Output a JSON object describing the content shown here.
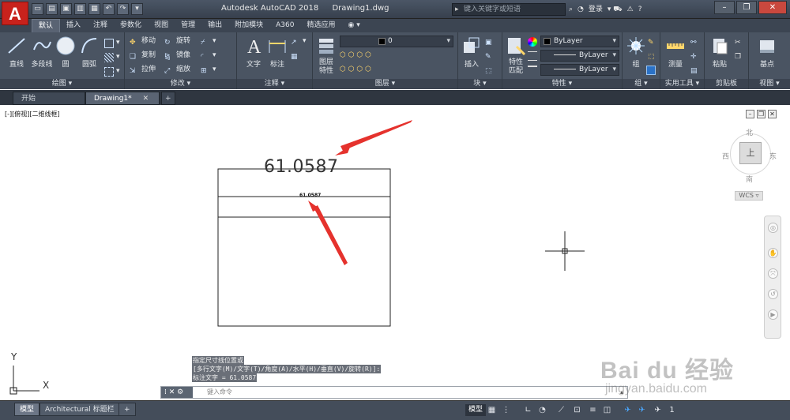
{
  "app": {
    "logo_letter": "A",
    "title_app": "Autodesk AutoCAD 2018",
    "title_file": "Drawing1.dwg",
    "search_placeholder": "键入关键字或短语",
    "signin_label": "登录"
  },
  "ribbon_tabs": [
    "默认",
    "插入",
    "注释",
    "参数化",
    "视图",
    "管理",
    "输出",
    "附加模块",
    "A360",
    "精选应用"
  ],
  "ribbon_active_tab": "默认",
  "panels": {
    "draw": {
      "title": "绘图 ▾",
      "tools": {
        "line": "直线",
        "polyline": "多段线",
        "circle": "圆",
        "arc": "圆弧"
      }
    },
    "modify": {
      "title": "修改 ▾",
      "tools": {
        "move": "移动",
        "rotate": "旋转",
        "copy": "复制",
        "mirror": "镜像",
        "stretch": "拉伸",
        "scale": "缩放"
      }
    },
    "annotation": {
      "title": "注释 ▾",
      "tools": {
        "text": "文字",
        "dimension": "标注"
      }
    },
    "layers": {
      "title": "图层 ▾",
      "tools": {
        "layer_props": "图层\n特性",
        "layer_value": "0"
      }
    },
    "block": {
      "title": "块 ▾",
      "tools": {
        "insert": "插入"
      }
    },
    "properties": {
      "title": "特性 ▾",
      "tools": {
        "match": "特性\n匹配",
        "color": "ByLayer",
        "linetype": "ByLayer",
        "lineweight": "ByLayer"
      }
    },
    "groups": {
      "title": "组 ▾",
      "tools": {
        "group": "组"
      }
    },
    "utilities": {
      "title": "实用工具 ▾",
      "tools": {
        "measure": "测量"
      }
    },
    "clipboard": {
      "title": "剪贴板",
      "tools": {
        "paste": "粘贴"
      }
    },
    "view": {
      "title": "视图 ▾",
      "tools": {
        "base": "基点"
      }
    }
  },
  "file_tabs": [
    {
      "label": "开始"
    },
    {
      "label": "Drawing1*",
      "close": "✕"
    },
    {
      "label": "+"
    }
  ],
  "viewport_label": "[-][俯视][二维线框]",
  "drawing": {
    "dim_value_large": "61.0587",
    "dim_value_small": "61.0587"
  },
  "viewcube": {
    "north": "北",
    "south": "南",
    "east": "东",
    "west": "西",
    "face": "上",
    "wcs": "WCS ▿"
  },
  "command": {
    "history": [
      "指定尺寸线位置或",
      "[多行文字(M)/文字(T)/角度(A)/水平(H)/垂直(V)/旋转(R)]:",
      "标注文字 = 61.0587"
    ],
    "placeholder": "键入命令"
  },
  "ucs": {
    "y": "Y",
    "x": "X"
  },
  "layout_tabs": [
    {
      "label": "模型"
    },
    {
      "label": "Architectural 标题栏"
    },
    {
      "label": "+"
    }
  ],
  "status": {
    "model_label": "模型"
  },
  "watermark": {
    "brand": "Bai du 经验",
    "url": "jingyan.baidu.com"
  },
  "colors": {
    "title_bg": "#3f4856",
    "ribbon_bg": "#4a5462",
    "canvas_bg": "#ffffff",
    "arrow_red": "#e5322d",
    "logo_red": "#c8221c"
  }
}
